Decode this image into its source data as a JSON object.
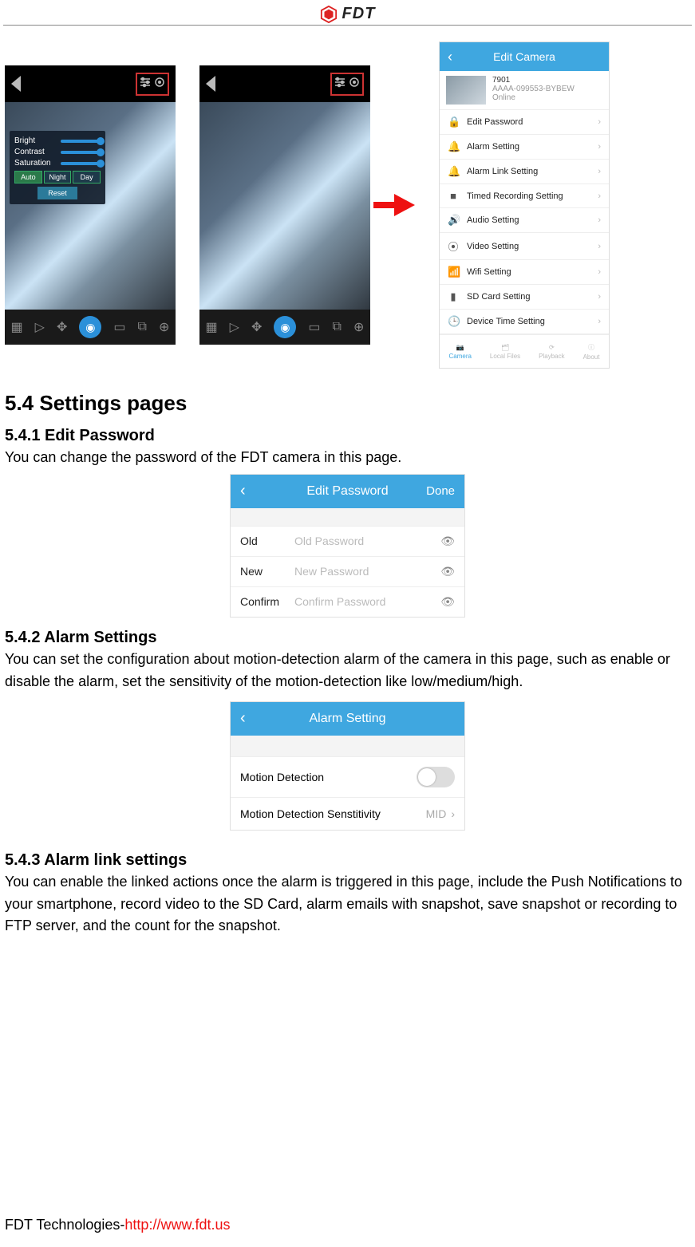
{
  "brand": {
    "name": "FDT"
  },
  "overlay": {
    "bright": "Bright",
    "contrast": "Contrast",
    "saturation": "Saturation",
    "auto": "Auto",
    "night": "Night",
    "day": "Day",
    "reset": "Reset"
  },
  "edit_camera": {
    "title": "Edit Camera",
    "cam_name": "7901",
    "cam_id": "AAAA-099553-BYBEW",
    "cam_status": "Online",
    "rows": [
      "Edit Password",
      "Alarm Setting",
      "Alarm Link Setting",
      "Timed Recording Setting",
      "Audio Setting",
      "Video Setting",
      "Wifi Setting",
      "SD Card Setting",
      "Device Time Setting"
    ],
    "footer": [
      "Camera",
      "Local Files",
      "Playback",
      "About"
    ]
  },
  "sections": {
    "h2": "5.4 Settings pages",
    "s1_h": "5.4.1 Edit Password",
    "s1_p": "You can change the password of the FDT camera in this page.",
    "s2_h": "5.4.2 Alarm Settings",
    "s2_p": "You can set the configuration about motion-detection alarm of the camera in this page, such as enable or disable the alarm, set the sensitivity of the motion-detection like low/medium/high.",
    "s3_h": "5.4.3 Alarm link settings",
    "s3_p": "You can enable the linked actions once the alarm is triggered in this page, include the Push Notifications to your smartphone, record video to the SD Card, alarm emails with snapshot, save snapshot or recording to FTP server, and the count for the snapshot."
  },
  "edit_password": {
    "title": "Edit Password",
    "done": "Done",
    "rows": [
      {
        "label": "Old",
        "placeholder": "Old Password"
      },
      {
        "label": "New",
        "placeholder": "New Password"
      },
      {
        "label": "Confirm",
        "placeholder": "Confirm Password"
      }
    ]
  },
  "alarm_setting": {
    "title": "Alarm Setting",
    "row1": "Motion Detection",
    "row2": "Motion Detection Senstitivity",
    "row2_val": "MID"
  },
  "footer": {
    "company": "FDT Technologies-",
    "url": "http://www.fdt.us"
  }
}
